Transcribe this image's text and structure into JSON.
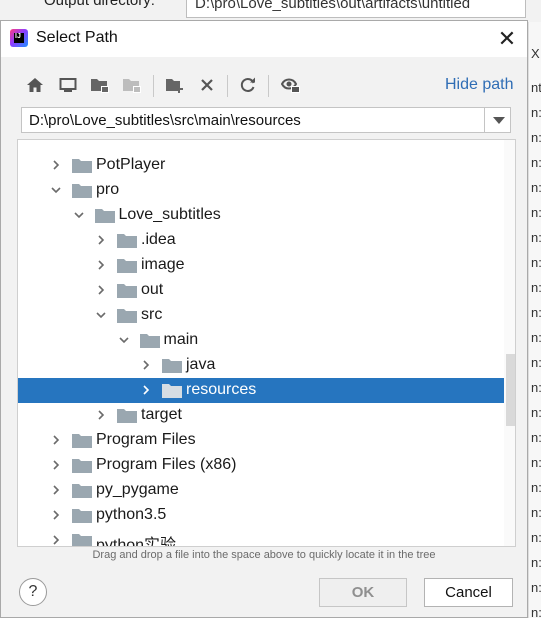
{
  "background": {
    "label": "Output directory:",
    "field": "D:\\pro\\Love_subtitles\\out\\artifacts\\untitled",
    "right_fragments": [
      "X",
      "nt",
      "n:",
      "n:",
      "n:",
      "n:",
      "n:",
      "n:",
      "n:",
      "n:",
      "n:",
      "n:",
      "n:",
      "n:",
      "n:",
      "n:",
      "n:",
      "n:",
      "n:",
      "n:",
      "n:",
      "n:",
      "n:",
      "n:"
    ]
  },
  "dialog": {
    "title": "Select Path",
    "app_icon_text": "IJ",
    "close_glyph": "✕"
  },
  "toolbar": {
    "buttons": [
      {
        "name": "home-icon"
      },
      {
        "name": "desktop-icon"
      },
      {
        "name": "project-folder-icon"
      },
      {
        "name": "module-folder-icon"
      },
      {
        "name": "new-folder-icon"
      },
      {
        "name": "delete-icon"
      },
      {
        "name": "refresh-icon"
      },
      {
        "name": "show-hidden-icon"
      }
    ],
    "hide_path_label": "Hide path"
  },
  "path": {
    "value": "D:\\pro\\Love_subtitles\\src\\main\\resources"
  },
  "tree": {
    "rows": [
      {
        "label": "PotPlayer",
        "depth": 0,
        "expanded": false
      },
      {
        "label": "pro",
        "depth": 0,
        "expanded": true
      },
      {
        "label": "Love_subtitles",
        "depth": 1,
        "expanded": true
      },
      {
        "label": ".idea",
        "depth": 2,
        "expanded": false
      },
      {
        "label": "image",
        "depth": 2,
        "expanded": false
      },
      {
        "label": "out",
        "depth": 2,
        "expanded": false
      },
      {
        "label": "src",
        "depth": 2,
        "expanded": true
      },
      {
        "label": "main",
        "depth": 3,
        "expanded": true
      },
      {
        "label": "java",
        "depth": 4,
        "expanded": false
      },
      {
        "label": "resources",
        "depth": 4,
        "expanded": false,
        "selected": true
      },
      {
        "label": "target",
        "depth": 2,
        "expanded": false
      },
      {
        "label": "Program Files",
        "depth": 0,
        "expanded": false
      },
      {
        "label": "Program Files (x86)",
        "depth": 0,
        "expanded": false
      },
      {
        "label": "py_pygame",
        "depth": 0,
        "expanded": false
      },
      {
        "label": "python3.5",
        "depth": 0,
        "expanded": false
      },
      {
        "label": "python实验",
        "depth": 0,
        "expanded": false
      }
    ]
  },
  "hint": "Drag and drop a file into the space above to quickly locate it in the tree",
  "buttons": {
    "help": "?",
    "ok": "OK",
    "cancel": "Cancel"
  },
  "colors": {
    "selection": "#2675bf",
    "link": "#2f6db5",
    "folder": "#9aa7b0"
  }
}
